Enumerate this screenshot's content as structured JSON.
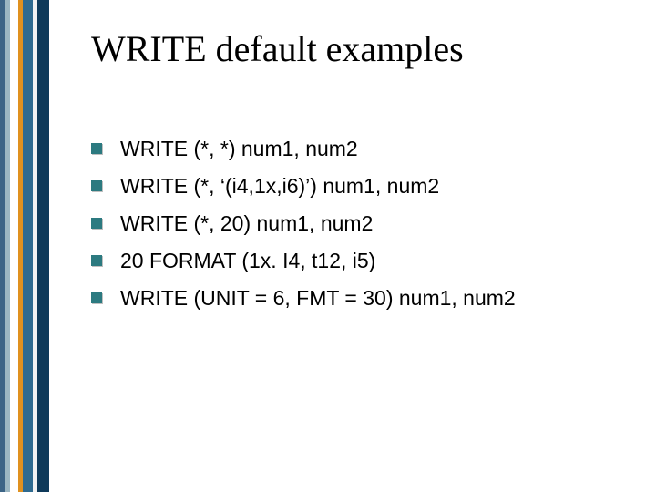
{
  "title": "WRITE default examples",
  "colors": {
    "bullet": "#2c7a80",
    "sidebar": [
      "#3c6486",
      "#9bb6c2",
      "#ffffff",
      "#e0911f",
      "#2f6a8f",
      "#f2f2f2",
      "#0f3a5a"
    ]
  },
  "items": [
    "WRITE (*, *) num1, num2",
    "WRITE (*, ‘(i4,1x,i6)’) num1, num2",
    "WRITE (*, 20) num1, num2",
    "20 FORMAT (1x. I4, t12, i5)",
    "WRITE (UNIT = 6, FMT = 30) num1, num2"
  ]
}
